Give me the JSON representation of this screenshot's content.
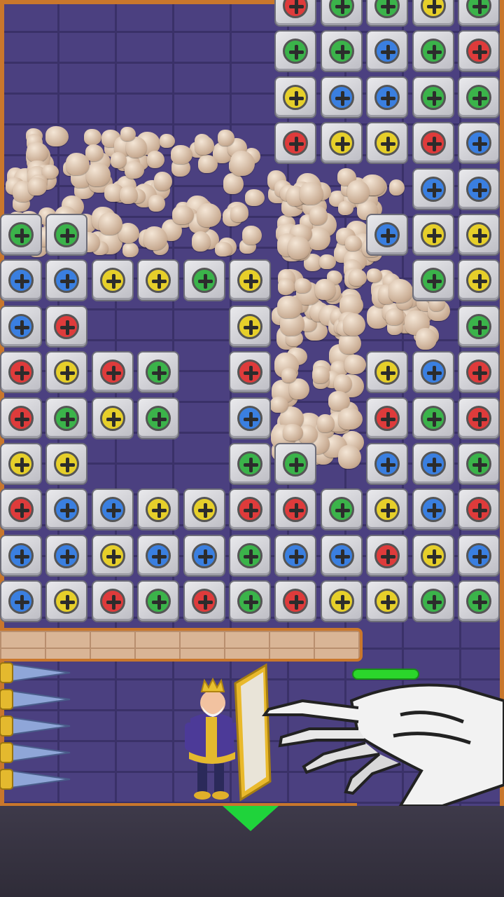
{
  "palette": {
    "green": "#3bb34a",
    "blue": "#3a7fe0",
    "yellow": "#e6cf2a",
    "red": "#de3b3b"
  },
  "bolt_icon": "plus-screw-icon",
  "puzzle_rows": [
    [
      "",
      "",
      "",
      "",
      "",
      "",
      "red",
      "green",
      "green",
      "yellow",
      "green"
    ],
    [
      "",
      "",
      "",
      "",
      "",
      "",
      "green",
      "green",
      "blue",
      "green",
      "red"
    ],
    [
      "",
      "",
      "",
      "",
      "",
      "",
      "yellow",
      "blue",
      "blue",
      "green",
      "green"
    ],
    [
      "",
      "",
      "",
      "",
      "",
      "",
      "red",
      "yellow",
      "yellow",
      "red",
      "blue"
    ],
    [
      "",
      "",
      "",
      "",
      "",
      "",
      "",
      "",
      "",
      "blue",
      "blue"
    ],
    [
      "green",
      "green",
      "",
      "",
      "",
      "",
      "",
      "",
      "blue",
      "yellow",
      "yellow"
    ],
    [
      "blue",
      "blue",
      "yellow",
      "yellow",
      "green",
      "yellow",
      "",
      "",
      "",
      "green",
      "yellow"
    ],
    [
      "blue",
      "red",
      "",
      "",
      "",
      "yellow",
      "",
      "",
      "",
      "",
      "green"
    ],
    [
      "red",
      "yellow",
      "red",
      "green",
      "",
      "red",
      "",
      "",
      "yellow",
      "blue",
      "red"
    ],
    [
      "red",
      "green",
      "yellow",
      "green",
      "",
      "blue",
      "",
      "",
      "red",
      "green",
      "red"
    ],
    [
      "yellow",
      "yellow",
      "",
      "",
      "",
      "green",
      "green",
      "",
      "blue",
      "blue",
      "green"
    ],
    [
      "red",
      "blue",
      "blue",
      "yellow",
      "yellow",
      "red",
      "red",
      "green",
      "yellow",
      "blue",
      "red"
    ],
    [
      "blue",
      "blue",
      "yellow",
      "blue",
      "blue",
      "green",
      "blue",
      "blue",
      "red",
      "yellow",
      "blue"
    ],
    [
      "blue",
      "yellow",
      "red",
      "green",
      "red",
      "green",
      "red",
      "yellow",
      "yellow",
      "green",
      "green"
    ]
  ],
  "characters": {
    "hero": "king",
    "enemy": "skeleton-hand",
    "hazard": "wall-spikes"
  },
  "enemy_health_fraction": 1.0
}
